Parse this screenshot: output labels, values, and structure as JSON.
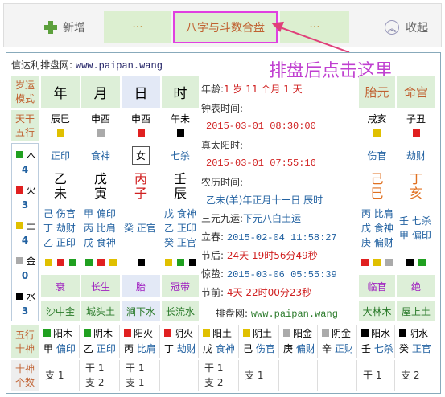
{
  "toolbar": {
    "new_label": "新增",
    "dots1_label": "···",
    "main_label": "八字与斗数合盘",
    "dots2_label": "···",
    "fold_label": "收起"
  },
  "annotation": "排盘后点击这里",
  "site": {
    "label": "信达利排盘网:",
    "url": "www.paipan.wang"
  },
  "left_labels": {
    "yunshi1": "岁运",
    "yunshi2": "模式",
    "tiangan1": "天干",
    "tiangan2": "五行"
  },
  "columns": {
    "year": "年",
    "month": "月",
    "day": "日",
    "hour": "时",
    "taiyuan": "胎元",
    "minggong": "命宫"
  },
  "ganzhi_row": {
    "year": "辰巳",
    "month": "申酉",
    "day": "申酉",
    "hour": "午未",
    "taiyuan": "戌亥",
    "minggong": "子丑"
  },
  "elements": [
    {
      "name": "木",
      "count": "4"
    },
    {
      "name": "火",
      "count": "3"
    },
    {
      "name": "土",
      "count": "4"
    },
    {
      "name": "金",
      "count": "0"
    },
    {
      "name": "水",
      "count": "3"
    }
  ],
  "shishen_top": {
    "year": "正印",
    "month": "食神",
    "day": "女",
    "hour": "七杀",
    "taiyuan": "伤官",
    "minggong": "劫财"
  },
  "pillars": {
    "year": {
      "gan": "乙",
      "zhi": "未"
    },
    "month": {
      "gan": "戊",
      "zhi": "寅"
    },
    "day": {
      "gan": "丙",
      "zhi": "子"
    },
    "hour": {
      "gan": "壬",
      "zhi": "辰"
    },
    "taiyuan": {
      "gan": "己",
      "zhi": "巳"
    },
    "minggong": {
      "gan": "丁",
      "zhi": "亥"
    }
  },
  "canggan": {
    "year": [
      "己 伤官",
      "丁 劫财",
      "乙 正印"
    ],
    "month": [
      "甲 偏印",
      "丙 比肩",
      "戊 食神"
    ],
    "day": [
      "癸 正官",
      "",
      ""
    ],
    "hour": [
      "戊 食神",
      "乙 正印",
      "癸 正官"
    ],
    "taiyuan": [
      "丙 比肩",
      "戊 食神",
      "庚 偏财"
    ],
    "minggong": [
      "壬 七杀",
      "甲 偏印",
      ""
    ]
  },
  "changsheng": {
    "year": "衰",
    "month": "长生",
    "day": "胎",
    "hour": "冠带",
    "taiyuan": "临官",
    "minggong": "绝"
  },
  "nayin": {
    "year": "沙中金",
    "month": "城头土",
    "day": "涧下水",
    "hour": "长流水",
    "taiyuan": "大林木",
    "minggong": "屋上土"
  },
  "info": {
    "age_label": "年龄:",
    "age_value": "1 岁 11 个月 1 天",
    "clock_label": "钟表时间:",
    "clock_value": "2015-03-01 08:30:00",
    "solar_label": "真太阳时:",
    "solar_value": "2015-03-01 07:55:16",
    "lunar_label": "农历时间:",
    "lunar_value": "乙未(羊)年正月十一日 辰时",
    "sanyuan_label": "三元九运:",
    "sanyuan_value": "下元八白土运",
    "lichun_label": "立春:",
    "lichun_value": "2015-02-04 11:58:27",
    "jiehou_label": "节后:",
    "jiehou_value": "24天 19时56分49秒",
    "jingzhe_label": "惊蛰:",
    "jingzhe_value": "2015-03-06 05:55:39",
    "jieqian_label": "节前:",
    "jieqian_value": "4天 22时00分23秒",
    "site_label": "排盘网:",
    "site_value": "www.paipan.wang"
  },
  "bottom": {
    "label1": "五行",
    "label2": "十神",
    "label3": "十神",
    "label4": "个数",
    "stems": [
      {
        "head": "阳木",
        "gan": "甲",
        "ss": "偏印",
        "color": "#20a020"
      },
      {
        "head": "阴木",
        "gan": "乙",
        "ss": "正印",
        "color": "#20a020"
      },
      {
        "head": "阳火",
        "gan": "丙",
        "ss": "比肩",
        "color": "#e02020"
      },
      {
        "head": "阴火",
        "gan": "丁",
        "ss": "劫财",
        "color": "#e02020"
      },
      {
        "head": "阳土",
        "gan": "戊",
        "ss": "食神",
        "color": "#e0c000"
      },
      {
        "head": "阴土",
        "gan": "己",
        "ss": "伤官",
        "color": "#e0c000"
      },
      {
        "head": "阳金",
        "gan": "庚",
        "ss": "偏财",
        "color": "#aaaaaa"
      },
      {
        "head": "阴金",
        "gan": "辛",
        "ss": "正财",
        "color": "#aaaaaa"
      },
      {
        "head": "阳水",
        "gan": "壬",
        "ss": "七杀",
        "color": "#000000"
      },
      {
        "head": "阴水",
        "gan": "癸",
        "ss": "正官",
        "color": "#000000"
      }
    ],
    "counts": [
      {
        "gan": "",
        "zhi": "支 1"
      },
      {
        "gan": "干 1",
        "zhi": "支 2"
      },
      {
        "gan": "干 1",
        "zhi": "支 1"
      },
      {
        "gan": "",
        "zhi": ""
      },
      {
        "gan": "干 1",
        "zhi": "支 2"
      },
      {
        "gan": "",
        "zhi": "支 1"
      },
      {
        "gan": "",
        "zhi": ""
      },
      {
        "gan": "",
        "zhi": ""
      },
      {
        "gan": "干 1",
        "zhi": ""
      },
      {
        "gan": "",
        "zhi": "支 2"
      }
    ]
  }
}
